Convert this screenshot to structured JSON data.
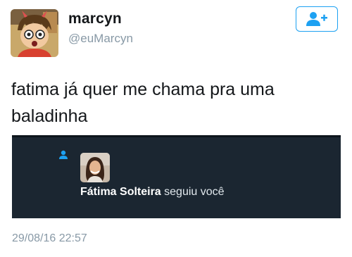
{
  "tweet": {
    "display_name": "marcyn",
    "handle": "@euMarcyn",
    "text": "fatima já quer me chama pra uma baladinha",
    "timestamp": "29/08/16 22:57"
  },
  "follow_button": {
    "icon": "add-user-icon",
    "color": "#1da1f2"
  },
  "notification": {
    "icon": "person-icon",
    "user_name": "Fátima Solteira",
    "action_text": "seguiu você",
    "background": "#1b2631"
  }
}
